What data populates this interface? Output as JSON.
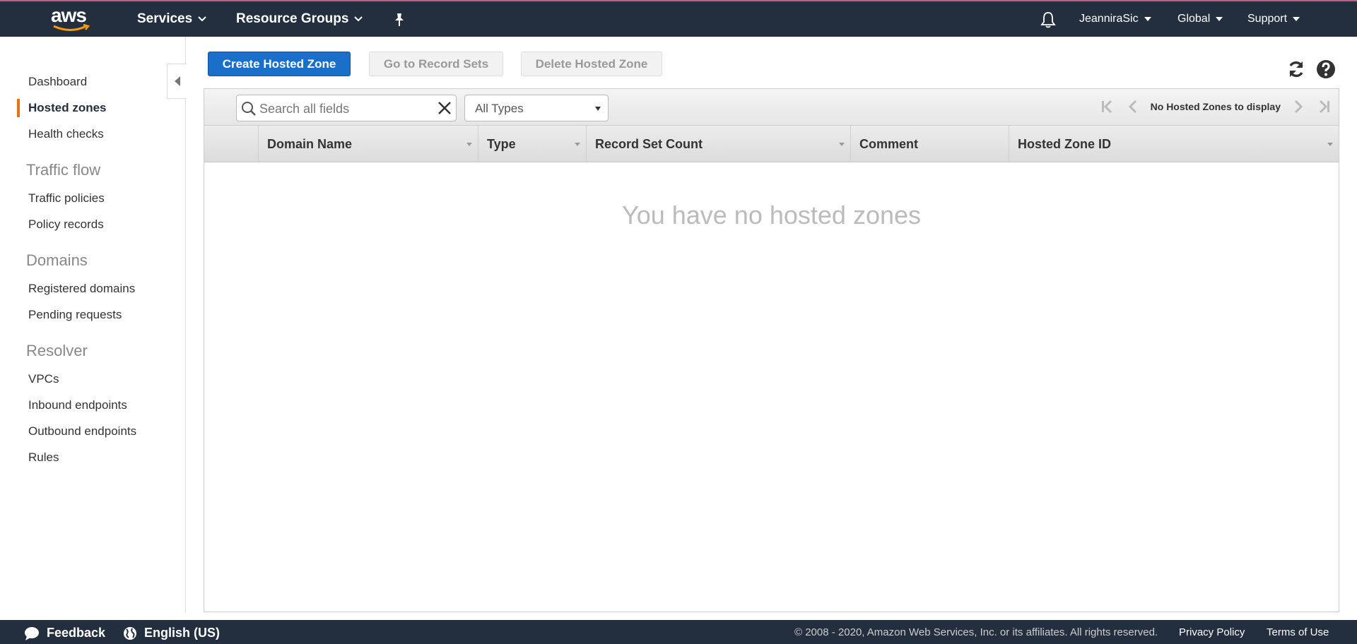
{
  "topnav": {
    "logo": "aws",
    "services_label": "Services",
    "resource_groups_label": "Resource Groups",
    "user_label": "JeanniraSic",
    "region_label": "Global",
    "support_label": "Support",
    "icons": [
      "pin-icon",
      "bell-icon"
    ]
  },
  "sidebar": {
    "items": [
      {
        "label": "Dashboard"
      },
      {
        "label": "Hosted zones",
        "active": true
      },
      {
        "label": "Health checks"
      }
    ],
    "traffic_flow": {
      "title": "Traffic flow",
      "items": [
        "Traffic policies",
        "Policy records"
      ]
    },
    "domains": {
      "title": "Domains",
      "items": [
        "Registered domains",
        "Pending requests"
      ]
    },
    "resolver": {
      "title": "Resolver",
      "items": [
        "VPCs",
        "Inbound endpoints",
        "Outbound endpoints",
        "Rules"
      ]
    }
  },
  "actions": {
    "create_label": "Create Hosted Zone",
    "goto_label": "Go to Record Sets",
    "delete_label": "Delete Hosted Zone"
  },
  "filter": {
    "search_placeholder": "Search all fields",
    "type_selected": "All Types"
  },
  "pager": {
    "status": "No Hosted Zones to display"
  },
  "table": {
    "columns": [
      "Domain Name",
      "Type",
      "Record Set Count",
      "Comment",
      "Hosted Zone ID"
    ],
    "rows": [],
    "empty_message": "You have no hosted zones"
  },
  "footer": {
    "feedback_label": "Feedback",
    "language_label": "English (US)",
    "copyright": "© 2008 - 2020, Amazon Web Services, Inc. or its affiliates. All rights reserved.",
    "privacy_label": "Privacy Policy",
    "terms_label": "Terms of Use"
  },
  "colors": {
    "nav_bg": "#232f3e",
    "primary": "#1a6fc9",
    "accent": "#ec7211"
  }
}
